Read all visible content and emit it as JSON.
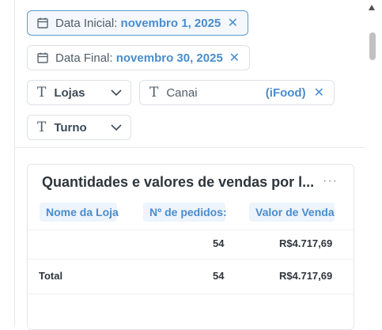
{
  "filters": {
    "start_date": {
      "label": "Data Inicial:",
      "value": "novembro 1, 2025",
      "clear_icon": "✕",
      "icon": "calendar-icon"
    },
    "end_date": {
      "label": "Data Final:",
      "value": "novembro 30, 2025",
      "clear_icon": "✕",
      "icon": "calendar-icon"
    },
    "stores": {
      "label": "Lojas",
      "icon": "text-type-icon"
    },
    "channel": {
      "label": "Canai",
      "value": "(iFood)",
      "clear_icon": "✕",
      "icon": "text-type-icon"
    },
    "shift": {
      "label": "Turno",
      "icon": "text-type-icon"
    },
    "type_glyph": "T"
  },
  "card": {
    "title": "Quantidades e valores de vendas por l...",
    "menu": "···",
    "columns": [
      "Nome da Loja",
      "Nº de pedidos:",
      "Valor de Venda"
    ],
    "rows": [
      {
        "store": "",
        "orders": "54",
        "value": "R$4.717,69"
      }
    ],
    "total": {
      "label": "Total",
      "orders": "54",
      "value": "R$4.717,69"
    }
  },
  "colors": {
    "accent": "#4a8ccc",
    "active_border": "#5b9bd1",
    "header_bg": "#eef4fb"
  }
}
